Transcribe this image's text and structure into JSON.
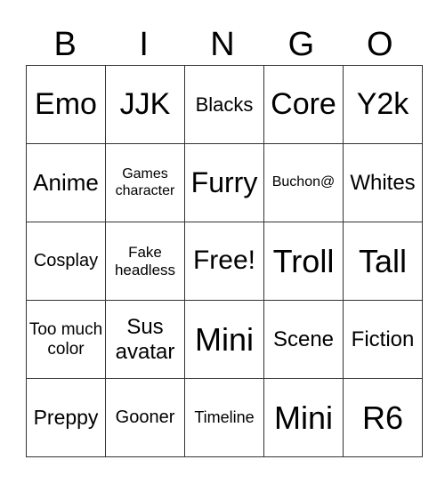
{
  "header": [
    "B",
    "I",
    "N",
    "G",
    "O"
  ],
  "rows": [
    [
      {
        "text": "Emo",
        "size": 34
      },
      {
        "text": "JJK",
        "size": 34
      },
      {
        "text": "Blacks",
        "size": 22
      },
      {
        "text": "Core",
        "size": 34
      },
      {
        "text": "Y2k",
        "size": 34
      }
    ],
    [
      {
        "text": "Anime",
        "size": 26
      },
      {
        "text": "Games character",
        "size": 16
      },
      {
        "text": "Furry",
        "size": 32
      },
      {
        "text": "Buchon@",
        "size": 16
      },
      {
        "text": "Whites",
        "size": 24
      }
    ],
    [
      {
        "text": "Cosplay",
        "size": 20
      },
      {
        "text": "Fake headless",
        "size": 17
      },
      {
        "text": "Free!",
        "size": 30
      },
      {
        "text": "Troll",
        "size": 36
      },
      {
        "text": "Tall",
        "size": 36
      }
    ],
    [
      {
        "text": "Too much color",
        "size": 19
      },
      {
        "text": "Sus avatar",
        "size": 24
      },
      {
        "text": "Mini",
        "size": 36
      },
      {
        "text": "Scene",
        "size": 24
      },
      {
        "text": "Fiction",
        "size": 24
      }
    ],
    [
      {
        "text": "Preppy",
        "size": 23
      },
      {
        "text": "Gooner",
        "size": 20
      },
      {
        "text": "Timeline",
        "size": 18
      },
      {
        "text": "Mini",
        "size": 36
      },
      {
        "text": "R6",
        "size": 36
      }
    ]
  ]
}
